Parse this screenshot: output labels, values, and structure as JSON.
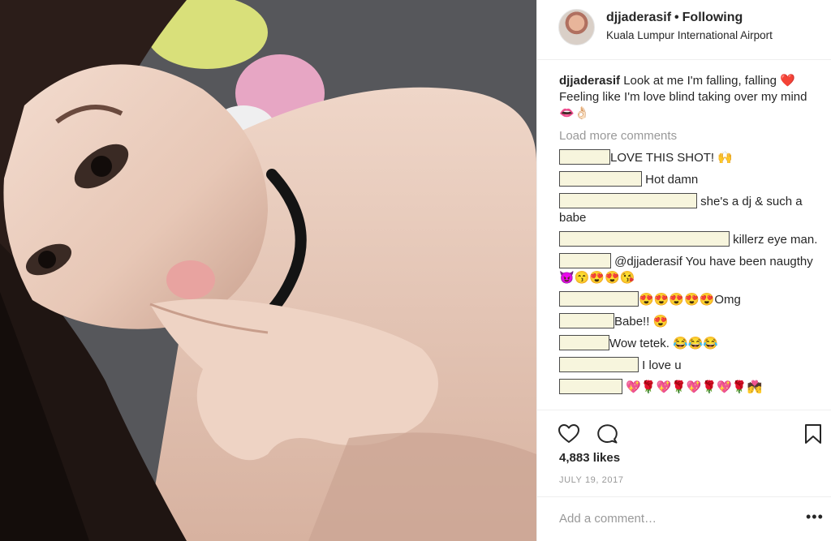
{
  "post": {
    "username": "djjaderasif",
    "separator": "•",
    "follow_status": "Following",
    "location": "Kuala Lumpur International Airport"
  },
  "caption": {
    "username": "djjaderasif",
    "text": " Look at me I'm falling, falling ❤️ Feeling like I'm love blind taking over my mind 👄👌🏻"
  },
  "load_more": "Load more comments",
  "comments": [
    {
      "text": "LOVE THIS SHOT! 🙌"
    },
    {
      "text": "Hot damn"
    },
    {
      "text": "she's a dj & such a babe"
    },
    {
      "text": "killerz eye man."
    },
    {
      "text": "@djjaderasif You have been naugthy😈😙😍😍😘"
    },
    {
      "text": "😍😍😍😍😍Omg"
    },
    {
      "text": "Babe!! 😍"
    },
    {
      "text": "Wow tetek. 😂😂😂"
    },
    {
      "text": "I love u"
    },
    {
      "text": "💖🌹💖🌹💖🌹💖🌹💏"
    }
  ],
  "likes": "4,883 likes",
  "date": "JULY 19, 2017",
  "add_comment": {
    "placeholder": "Add a comment…",
    "more": "•••"
  },
  "icons": {
    "like": "heart-icon",
    "comment": "speech-bubble-icon",
    "save": "bookmark-icon",
    "more": "ellipsis-icon"
  },
  "colors": {
    "text": "#262626",
    "muted": "#999999",
    "divider": "#efefef",
    "redaction_fill": "#f7f5dd"
  }
}
